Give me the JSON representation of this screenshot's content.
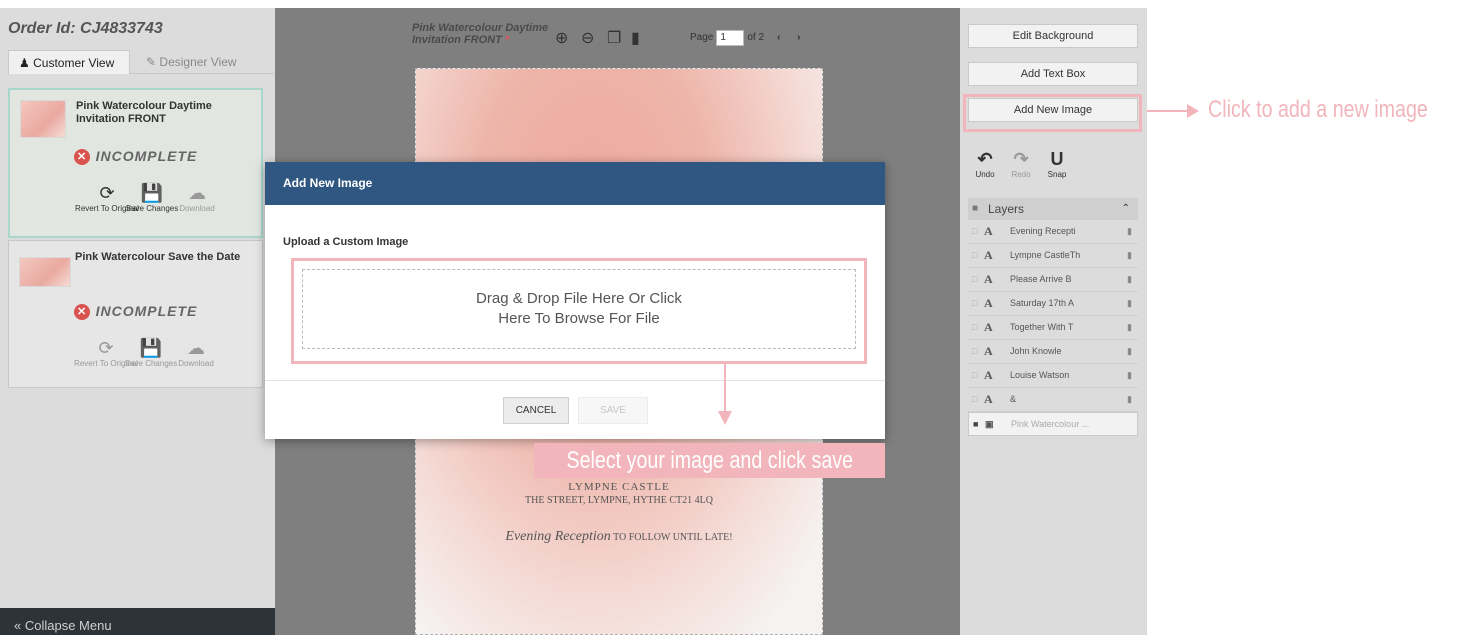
{
  "left_panel": {
    "order_id": "Order Id: CJ4833743",
    "tabs": [
      {
        "icon": "user-icon",
        "label": "Customer View"
      },
      {
        "icon": "pencil-icon",
        "label": "Designer View"
      }
    ],
    "cards": [
      {
        "title": "Pink Watercolour Daytime Invitation FRONT",
        "status": "INCOMPLETE",
        "actions": {
          "revert": "Revert To Original",
          "save": "Save Changes",
          "download": "Download"
        }
      },
      {
        "title": "Pink Watercolour Save the Date",
        "status": "INCOMPLETE",
        "actions": {
          "revert": "Revert To Original",
          "save": "Save Changes",
          "download": "Download"
        }
      }
    ],
    "collapse_label": "Collapse Menu"
  },
  "toolbar": {
    "doc_title": "Pink Watercolour Daytime Invitation FRONT",
    "required_mark": "*",
    "page_label": "Page",
    "page_current": "1",
    "page_of": "of 2"
  },
  "canvas": {
    "venue_line_1": "LYMPNE CASTLE",
    "venue_line_2": "THE STREET, LYMPNE, HYTHE CT21 4LQ",
    "reception_script": "Evening Reception",
    "reception_rest": "TO FOLLOW UNTIL LATE!"
  },
  "right_panel": {
    "edit_background": "Edit Background",
    "add_text_box": "Add Text Box",
    "add_new_image": "Add New Image",
    "undo": "Undo",
    "redo": "Redo",
    "snap": "Snap",
    "layers_title": "Layers",
    "layers": [
      {
        "type": "text",
        "name": "Evening Recepti"
      },
      {
        "type": "text",
        "name": "Lympne CastleTh"
      },
      {
        "type": "text",
        "name": "Please Arrive B"
      },
      {
        "type": "text",
        "name": "Saturday 17th A"
      },
      {
        "type": "text",
        "name": "Together With T"
      },
      {
        "type": "text",
        "name": "John Knowle"
      },
      {
        "type": "text",
        "name": "Louise Watson"
      },
      {
        "type": "text",
        "name": "&"
      },
      {
        "type": "image",
        "name": "Pink Watercolour ..."
      }
    ]
  },
  "modal": {
    "title": "Add New Image",
    "subtitle": "Upload a Custom Image",
    "drop_line_1": "Drag & Drop File Here Or Click",
    "drop_line_2": "Here To Browse For File",
    "cancel": "CANCEL",
    "save": "SAVE"
  },
  "annotations": {
    "add_image_hint": "Click to add a new image",
    "select_hint": "Select your image and click save",
    "accent_color": "#f1b5bb"
  },
  "colors": {
    "modal_header": "#2f5781",
    "incomplete_icon": "#d9534f",
    "collapse_bar": "#2e3338"
  }
}
